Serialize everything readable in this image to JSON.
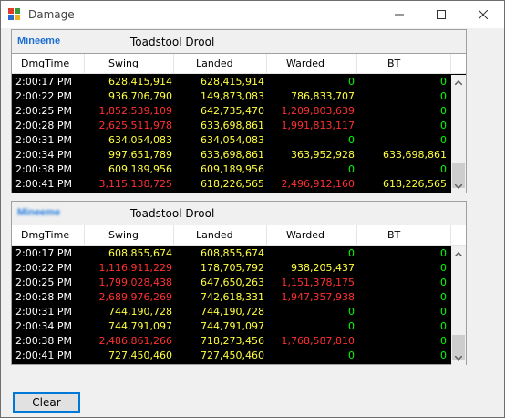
{
  "window": {
    "title": "Damage"
  },
  "columns": [
    "DmgTime",
    "Swing",
    "Landed",
    "Warded",
    "BT"
  ],
  "colors": {
    "white": "#ffffff",
    "yellow": "#ffff40",
    "red": "#ff3030",
    "green": "#00ff00",
    "accent": "#1e6fd0"
  },
  "panels": [
    {
      "player": "Mineeme",
      "target": "Toadstool Drool",
      "rows": [
        {
          "time": "2:00:17 PM",
          "swing": "628,415,914",
          "swing_color": "yellow",
          "landed": "628,415,914",
          "warded": "0",
          "warded_color": "green",
          "bt": "0"
        },
        {
          "time": "2:00:22 PM",
          "swing": "936,706,790",
          "swing_color": "yellow",
          "landed": "149,873,083",
          "warded": "786,833,707",
          "warded_color": "yellow",
          "bt": "0"
        },
        {
          "time": "2:00:25 PM",
          "swing": "1,852,539,109",
          "swing_color": "red",
          "landed": "642,735,470",
          "warded": "1,209,803,639",
          "warded_color": "red",
          "bt": "0"
        },
        {
          "time": "2:00:28 PM",
          "swing": "2,625,511,978",
          "swing_color": "red",
          "landed": "633,698,861",
          "warded": "1,991,813,117",
          "warded_color": "red",
          "bt": "0"
        },
        {
          "time": "2:00:31 PM",
          "swing": "634,054,083",
          "swing_color": "yellow",
          "landed": "634,054,083",
          "warded": "0",
          "warded_color": "green",
          "bt": "0"
        },
        {
          "time": "2:00:34 PM",
          "swing": "997,651,789",
          "swing_color": "yellow",
          "landed": "633,698,861",
          "warded": "363,952,928",
          "warded_color": "yellow",
          "bt": "633,698,861"
        },
        {
          "time": "2:00:38 PM",
          "swing": "609,189,956",
          "swing_color": "yellow",
          "landed": "609,189,956",
          "warded": "0",
          "warded_color": "green",
          "bt": "0"
        },
        {
          "time": "2:00:41 PM",
          "swing": "3,115,138,725",
          "swing_color": "red",
          "landed": "618,226,565",
          "warded": "2,496,912,160",
          "warded_color": "red",
          "bt": "618,226,565"
        }
      ]
    },
    {
      "player": "Mineeme",
      "target": "Toadstool Drool",
      "rows": [
        {
          "time": "2:00:17 PM",
          "swing": "608,855,674",
          "swing_color": "yellow",
          "landed": "608,855,674",
          "warded": "0",
          "warded_color": "green",
          "bt": "0"
        },
        {
          "time": "2:00:22 PM",
          "swing": "1,116,911,229",
          "swing_color": "red",
          "landed": "178,705,792",
          "warded": "938,205,437",
          "warded_color": "yellow",
          "bt": "0"
        },
        {
          "time": "2:00:25 PM",
          "swing": "1,799,028,438",
          "swing_color": "red",
          "landed": "647,650,263",
          "warded": "1,151,378,175",
          "warded_color": "red",
          "bt": "0"
        },
        {
          "time": "2:00:28 PM",
          "swing": "2,689,976,269",
          "swing_color": "red",
          "landed": "742,618,331",
          "warded": "1,947,357,938",
          "warded_color": "red",
          "bt": "0"
        },
        {
          "time": "2:00:31 PM",
          "swing": "744,190,728",
          "swing_color": "yellow",
          "landed": "744,190,728",
          "warded": "0",
          "warded_color": "green",
          "bt": "0"
        },
        {
          "time": "2:00:34 PM",
          "swing": "744,791,097",
          "swing_color": "yellow",
          "landed": "744,791,097",
          "warded": "0",
          "warded_color": "green",
          "bt": "0"
        },
        {
          "time": "2:00:38 PM",
          "swing": "2,486,861,266",
          "swing_color": "red",
          "landed": "718,273,456",
          "warded": "1,768,587,810",
          "warded_color": "red",
          "bt": "0"
        },
        {
          "time": "2:00:41 PM",
          "swing": "727,450,460",
          "swing_color": "yellow",
          "landed": "727,450,460",
          "warded": "0",
          "warded_color": "green",
          "bt": "0"
        }
      ]
    }
  ],
  "buttons": {
    "clear": "Clear"
  },
  "icons": {
    "app": "app-icon",
    "minimize": "minimize-icon",
    "maximize": "maximize-icon",
    "close": "close-icon"
  }
}
